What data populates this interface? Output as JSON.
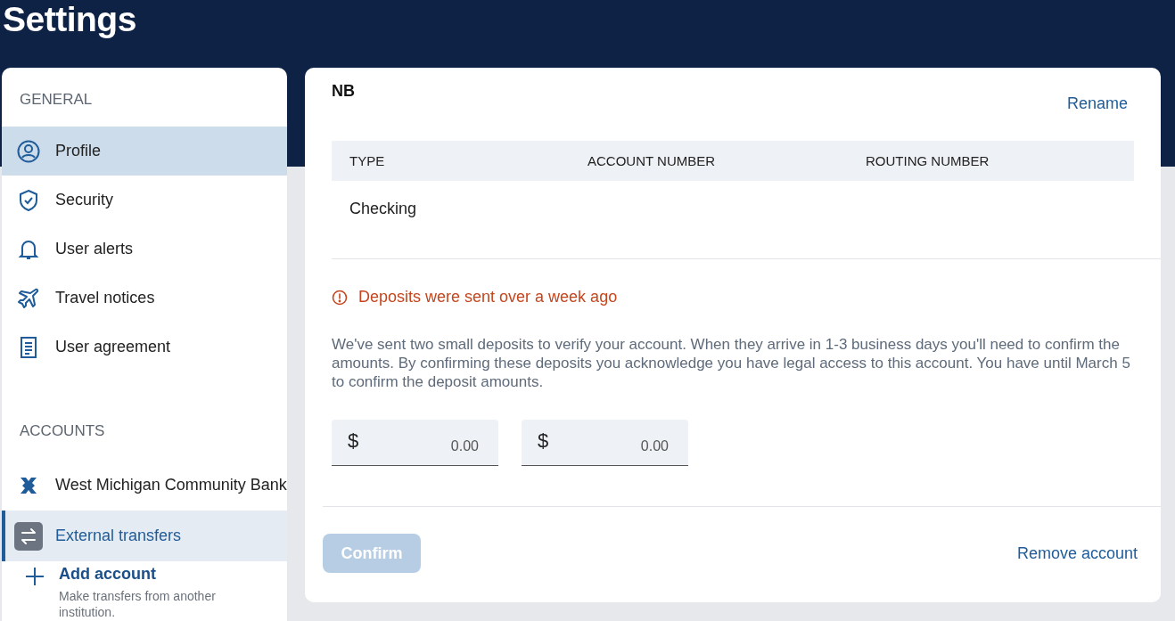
{
  "page_title": "Settings",
  "sidebar": {
    "sections": [
      {
        "heading": "GENERAL",
        "kind": "nav",
        "items": [
          {
            "label": "Profile",
            "selected": true
          },
          {
            "label": "Security",
            "selected": false
          },
          {
            "label": "User alerts",
            "selected": false
          },
          {
            "label": "Travel notices",
            "selected": false
          },
          {
            "label": "User agreement",
            "selected": false
          }
        ]
      },
      {
        "heading": "ACCOUNTS",
        "kind": "accounts",
        "items": [
          {
            "label": "West Michigan Community Bank",
            "selected": false
          },
          {
            "label": "External transfers",
            "selected": true
          }
        ]
      }
    ],
    "add_account": {
      "label": "Add account",
      "description": "Make transfers from another institution."
    }
  },
  "account": {
    "name": "NB",
    "rename": "Rename",
    "table": {
      "columns": [
        "TYPE",
        "ACCOUNT NUMBER",
        "ROUTING NUMBER"
      ],
      "rows": [
        [
          "Checking"
        ]
      ]
    },
    "warning": "Deposits were sent over a week ago",
    "message": "We've sent two small deposits to verify your account. When they arrive in 1-3 business days you'll need to confirm the amounts. By confirming these deposits you acknowledge you have legal access to this account. You have until March 5 to confirm the deposit amounts.",
    "amount_fields": [
      {
        "prefix": "$",
        "placeholder": "0.00"
      },
      {
        "prefix": "$",
        "placeholder": "0.00"
      }
    ],
    "confirm": {
      "label": "Confirm",
      "disabled": true
    },
    "remove": "Remove account"
  }
}
